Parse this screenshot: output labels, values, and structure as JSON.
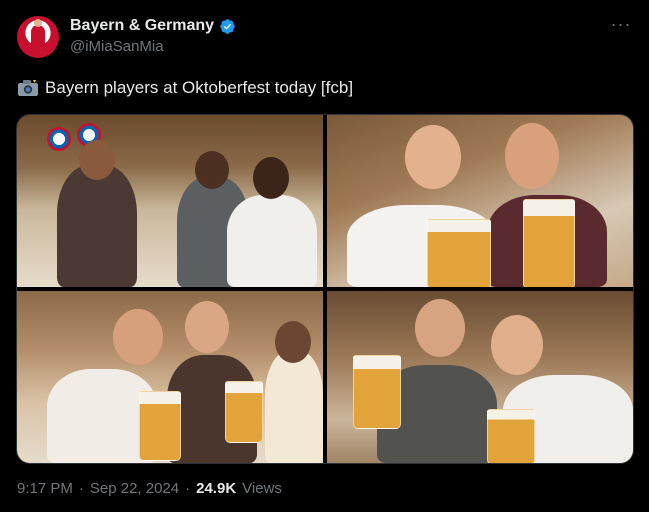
{
  "author": {
    "display_name": "Bayern & Germany",
    "handle": "@iMiaSanMia"
  },
  "tweet": {
    "text": "Bayern players at Oktoberfest today [fcb]",
    "leading_icon": "camera-with-flash-icon"
  },
  "meta": {
    "time": "9:17 PM",
    "separator1": "·",
    "date": "Sep 22, 2024",
    "separator2": "·",
    "views_count": "24.9K",
    "views_label": "Views"
  },
  "icons": {
    "verified": "verified-badge-icon",
    "more": "more-options-icon"
  },
  "colors": {
    "background": "#000000",
    "text": "#e7e9ea",
    "muted": "#71767b",
    "verified_blue": "#1d9bf0"
  }
}
